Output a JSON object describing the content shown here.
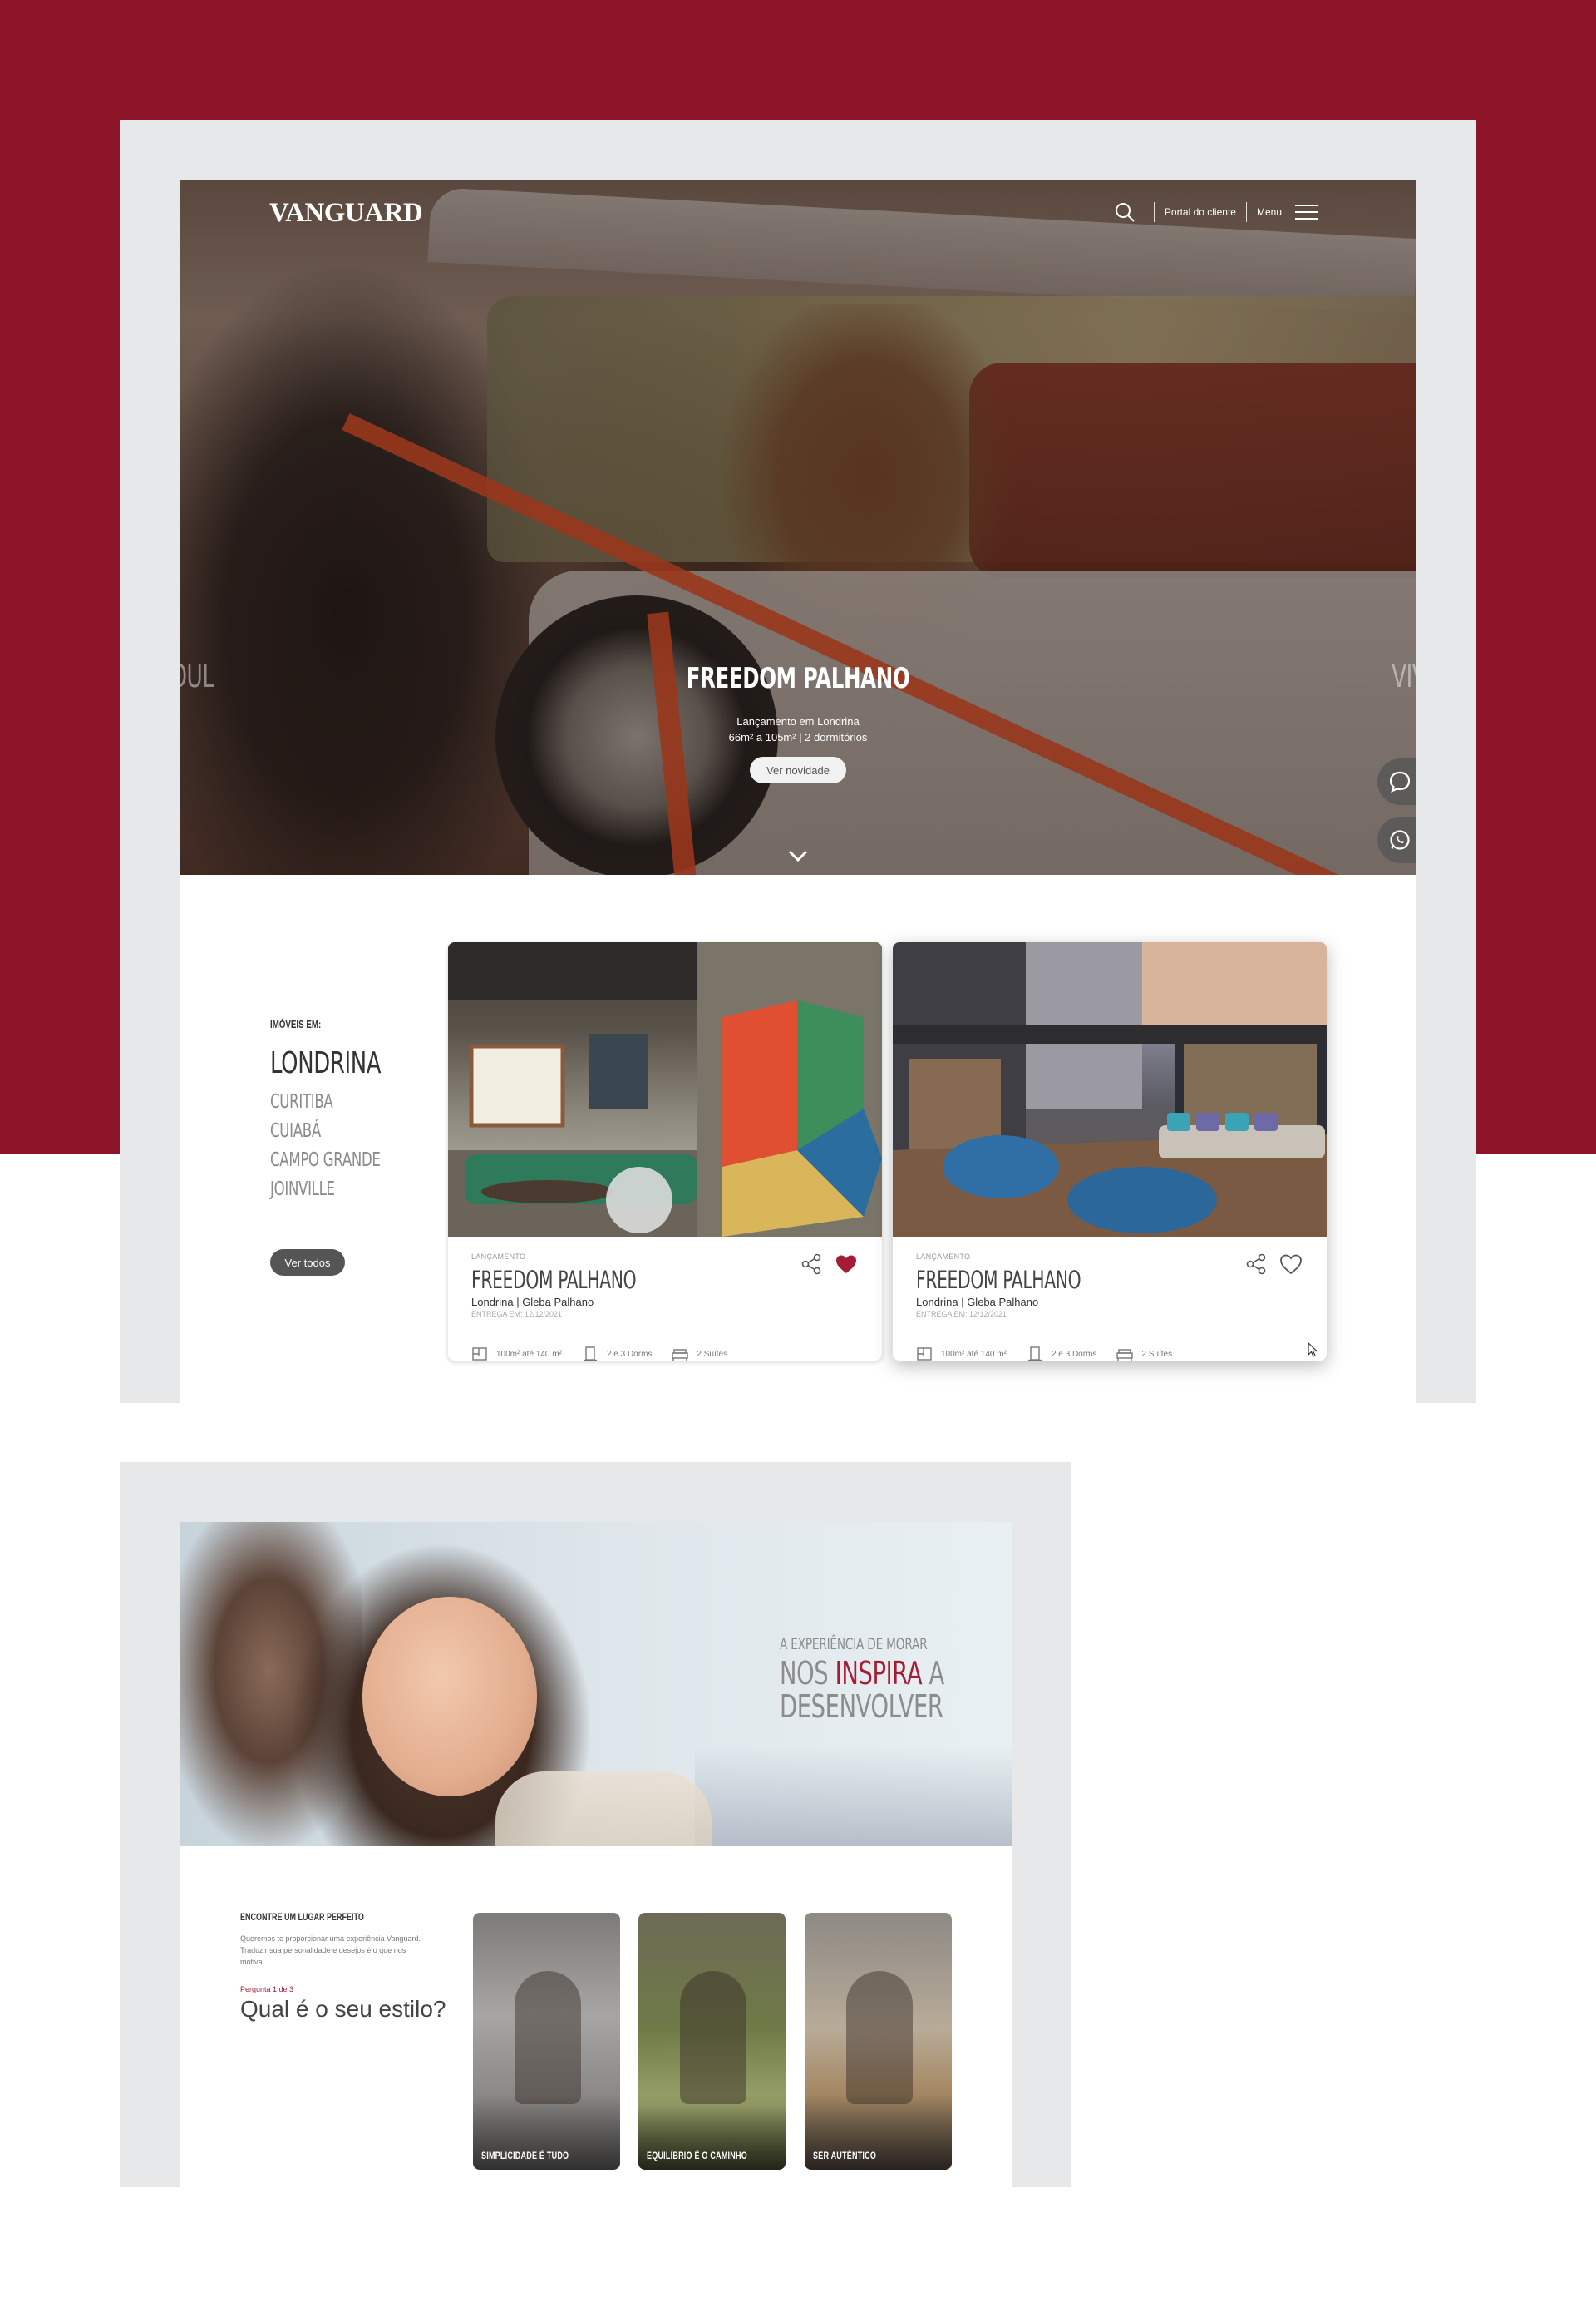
{
  "colors": {
    "brand_red": "#8e1529",
    "accent_red": "#a51c35",
    "frame_gray": "#e7e8e9",
    "text_dark": "#333333",
    "text_muted": "#8a8a8a"
  },
  "header": {
    "logo": "VANGUARD",
    "portal_label": "Portal do cliente",
    "menu_label": "Menu",
    "icons": [
      "search-icon",
      "menu-icon"
    ]
  },
  "hero": {
    "side_left": "SOUL",
    "side_right": "VIVE",
    "title": "FREEDOM PALHANO",
    "subtitle_1": "Lançamento em Londrina",
    "subtitle_2": "66m² a 105m² | 2 dormitórios",
    "cta_label": "Ver novidade",
    "icons": [
      "chevron-down-icon",
      "chat-icon",
      "whatsapp-icon"
    ]
  },
  "listings": {
    "label": "IMÓVEIS EM:",
    "current_city": "LONDRINA",
    "other_cities": [
      "CURITIBA",
      "CUIABÁ",
      "CAMPO GRANDE",
      "JOINVILLE"
    ],
    "view_all_label": "Ver todos",
    "cards": [
      {
        "kicker": "LANÇAMENTO",
        "title": "FREEDOM PALHANO",
        "location": "Londrina | Gleba Palhano",
        "delivery": "ENTREGA EM: 12/12/2021",
        "favorited": true,
        "features": {
          "area": "100m² até 140 m²",
          "dorms": "2 e 3 Dorms",
          "suites": "2 Suítes"
        }
      },
      {
        "kicker": "LANÇAMENTO",
        "title": "FREEDOM PALHANO",
        "location": "Londrina | Gleba Palhano",
        "delivery": "ENTREGA EM: 12/12/2021",
        "favorited": false,
        "features": {
          "area": "100m² até 140 m²",
          "dorms": "2 e 3 Dorms",
          "suites": "2 Suítes"
        }
      }
    ]
  },
  "experience": {
    "small": "A EXPERIÊNCIA DE MORAR",
    "line1_pre": "NOS ",
    "line1_accent": "INSPIRA",
    "line1_post": " A",
    "line2": "DESENVOLVER"
  },
  "quiz": {
    "label": "ENCONTRE UM LUGAR PERFEITO",
    "description": "Queremos te proporcionar uma experiência Vanguard. Traduzir sua personalidade e desejos é o que nos motiva.",
    "step": "Pergunta 1 de 3",
    "question": "Qual é o seu estilo?",
    "options": [
      "SIMPLICIDADE É TUDO",
      "EQUILÍBRIO É O CAMINHO",
      "SER AUTÊNTICO"
    ]
  }
}
